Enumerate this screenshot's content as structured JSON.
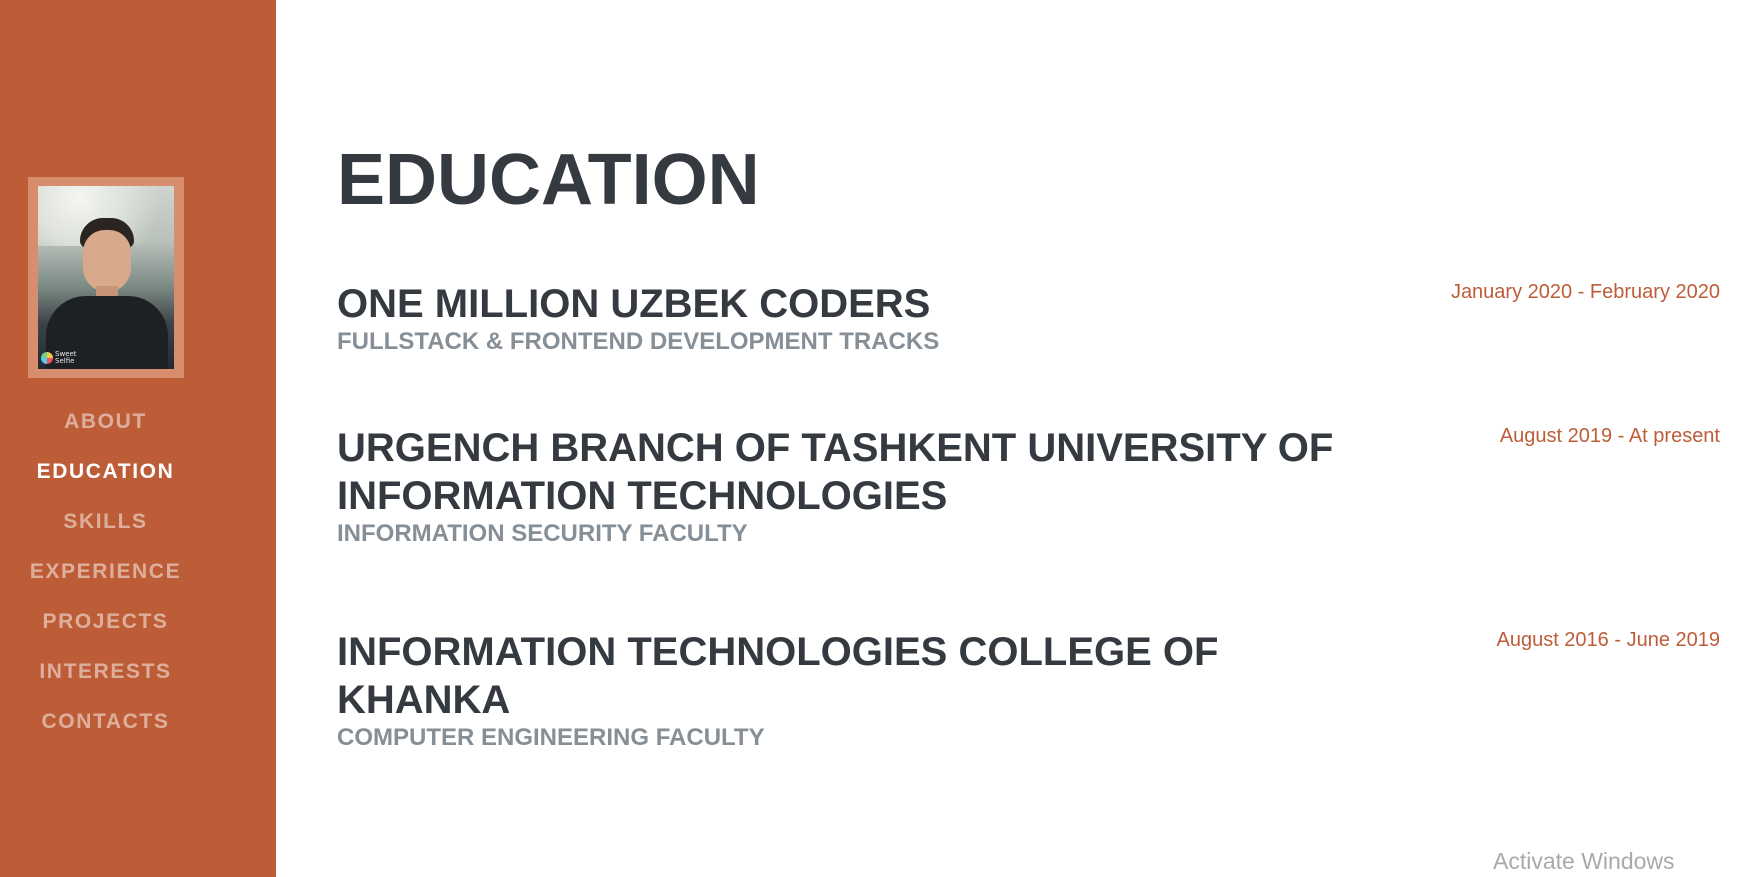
{
  "colors": {
    "primary": "#bd5d38",
    "heading": "#343a40",
    "subheading": "#868e96"
  },
  "sidebar": {
    "avatar": {
      "image": "profile-photo",
      "badge_text": "Sweet Selfie"
    },
    "nav": [
      {
        "label": "ABOUT",
        "active": false
      },
      {
        "label": "EDUCATION",
        "active": true
      },
      {
        "label": "SKILLS",
        "active": false
      },
      {
        "label": "EXPERIENCE",
        "active": false
      },
      {
        "label": "PROJECTS",
        "active": false
      },
      {
        "label": "INTERESTS",
        "active": false
      },
      {
        "label": "CONTACTS",
        "active": false
      }
    ]
  },
  "main": {
    "section_title": "EDUCATION",
    "entries": [
      {
        "title": "ONE MILLION UZBEK CODERS",
        "subtitle": "FULLSTACK & FRONTEND DEVELOPMENT TRACKS",
        "date": "January 2020 - February 2020"
      },
      {
        "title": "URGENCH BRANCH OF TASHKENT UNIVERSITY OF INFORMATION TECHNOLOGIES",
        "subtitle": "INFORMATION SECURITY FACULTY",
        "date": "August 2019 - At present"
      },
      {
        "title": "INFORMATION TECHNOLOGIES COLLEGE OF KHANKA",
        "subtitle": "COMPUTER ENGINEERING FACULTY",
        "date": "August 2016 - June 2019"
      }
    ]
  },
  "overlay": {
    "watermark": "Activate Windows"
  }
}
